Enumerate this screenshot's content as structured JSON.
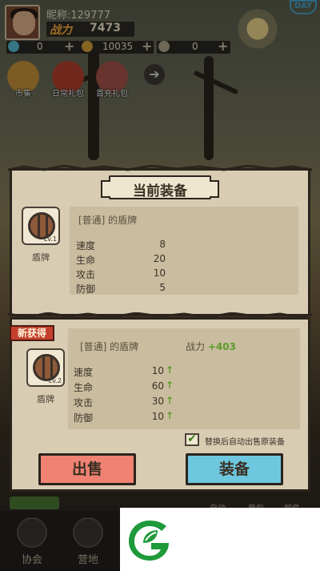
{
  "hud": {
    "nickname": "昵称:129777",
    "power_label": "战力",
    "power_value": "7473",
    "corner_badge": "DAY",
    "resources": [
      {
        "icon": "gem-icon",
        "value": "0"
      },
      {
        "icon": "coin-icon",
        "value": "10035"
      },
      {
        "icon": "star-icon",
        "value": "0"
      }
    ],
    "shortcuts": [
      {
        "label": "市集",
        "icon": "market-icon"
      },
      {
        "label": "日常礼包",
        "icon": "gift-icon"
      },
      {
        "label": "首充礼包",
        "icon": "first-recharge-icon"
      }
    ]
  },
  "dialog": {
    "title": "当前装备",
    "current": {
      "slot_label": "Lv.1",
      "item_name": "盾牌",
      "equip_name": "[普通] 的盾牌",
      "stats": [
        {
          "label": "速度",
          "value": "8"
        },
        {
          "label": "生命",
          "value": "20"
        },
        {
          "label": "攻击",
          "value": "10"
        },
        {
          "label": "防御",
          "value": "5"
        }
      ]
    },
    "new_tag": "新获得",
    "new": {
      "slot_label": "Lv.2",
      "item_name": "盾牌",
      "equip_name": "[普通] 的盾牌",
      "power_label": "战力",
      "power_delta": "+403",
      "stats": [
        {
          "label": "速度",
          "value": "10"
        },
        {
          "label": "生命",
          "value": "60"
        },
        {
          "label": "攻击",
          "value": "30"
        },
        {
          "label": "防御",
          "value": "10"
        }
      ]
    },
    "auto_sell_text": "替换后自动出售原装备",
    "auto_sell_checked": true,
    "sell_button": "出售",
    "equip_button": "装备"
  },
  "bottom": {
    "nav": [
      {
        "label": "协会"
      },
      {
        "label": "营地"
      }
    ],
    "tabs": [
      "自动",
      "背包",
      "邮件"
    ]
  },
  "colors": {
    "sell": "#ef8273",
    "equip": "#6ec7de",
    "panel": "#d8ccb3",
    "up": "#5e9c2a"
  }
}
